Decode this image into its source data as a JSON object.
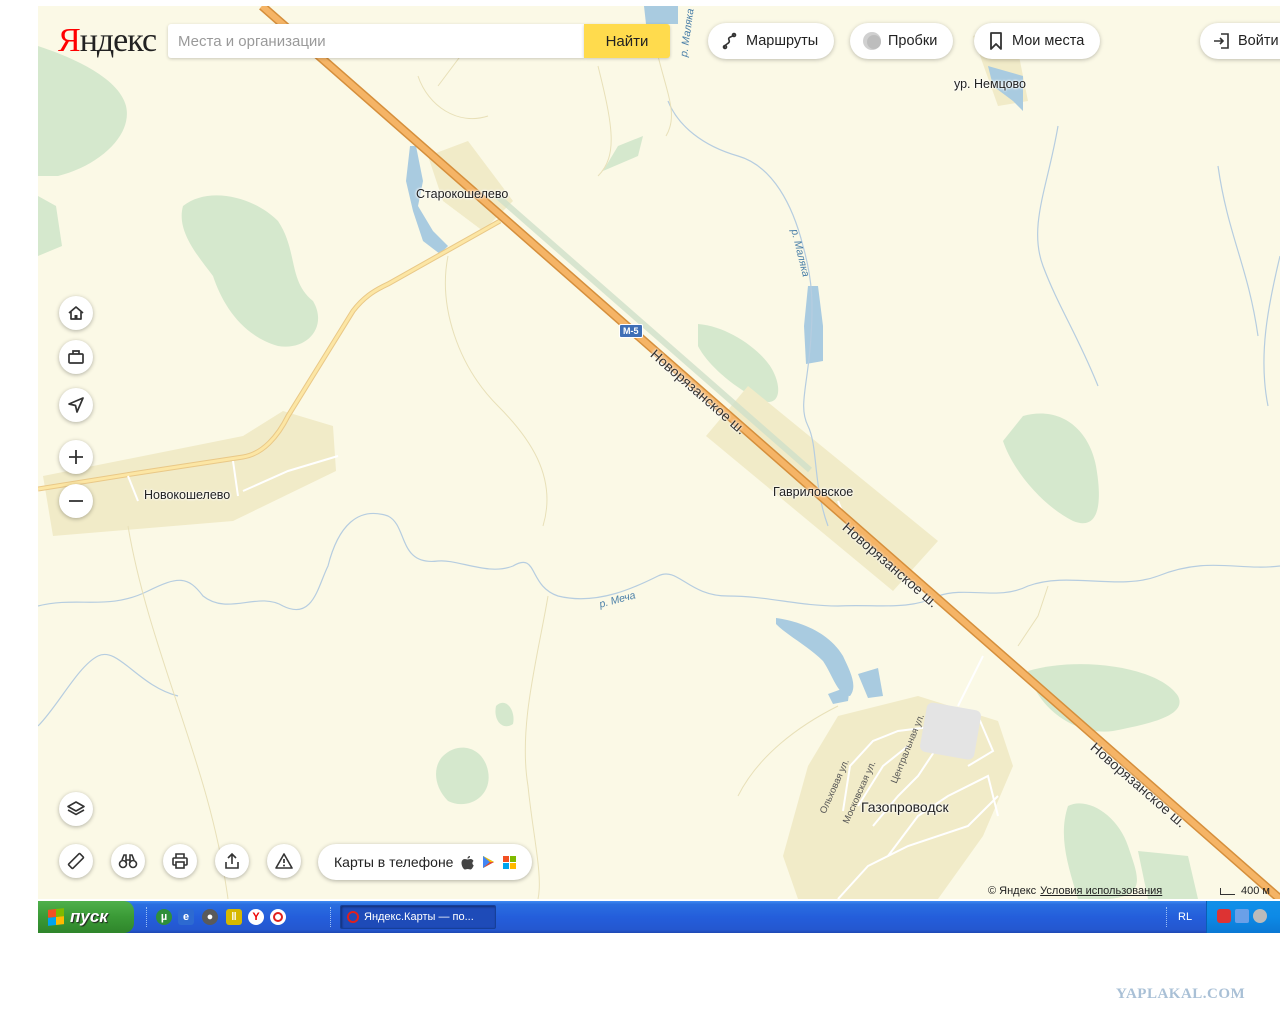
{
  "header": {
    "logo_first": "Я",
    "logo_rest": "ндекс",
    "search_placeholder": "Места и организации",
    "find_label": "Найти",
    "routes_label": "Маршруты",
    "traffic_label": "Пробки",
    "places_label": "Мои места",
    "login_label": "Войти"
  },
  "map": {
    "places": {
      "starokoshelevo": "Старокошелево",
      "novokoshelevo": "Новокошелево",
      "gavrilovskoe": "Гавриловское",
      "gazoprovodsk": "Газопроводск",
      "nemtsovo": "ур. Немцово"
    },
    "roads": {
      "highway_name": "Новорязанское ш.",
      "shield": "М-5"
    },
    "rivers": {
      "maliaka_top": "р. Маляка",
      "maliaka": "р. Маляка",
      "mecha": "р. Меча"
    },
    "streets": {
      "olkhovaya": "Ольховая ул.",
      "moskovskaya": "Московская ул.",
      "tsentralnaya": "Центральная ул."
    }
  },
  "controls": {
    "home_icon": "home-icon",
    "work_icon": "briefcase-icon",
    "locate_icon": "locate-arrow-icon",
    "layers_icon": "layers-icon",
    "phone_label": "Карты в телефоне"
  },
  "footer": {
    "copyright": "© Яндекс",
    "terms": "Условия использования",
    "scale": "400 м"
  },
  "taskbar": {
    "start_label": "пуск",
    "task_label": "Яндекс.Карты — по...",
    "lang": "RL"
  },
  "watermark": "YAPLAKAL.COM",
  "colors": {
    "map_bg": "#fbf9e6",
    "forest": "#d5e8cd",
    "highway": "#f2a857",
    "water": "#a9cbe0",
    "find_button": "#ffdb4d",
    "taskbar": "#245edb"
  }
}
